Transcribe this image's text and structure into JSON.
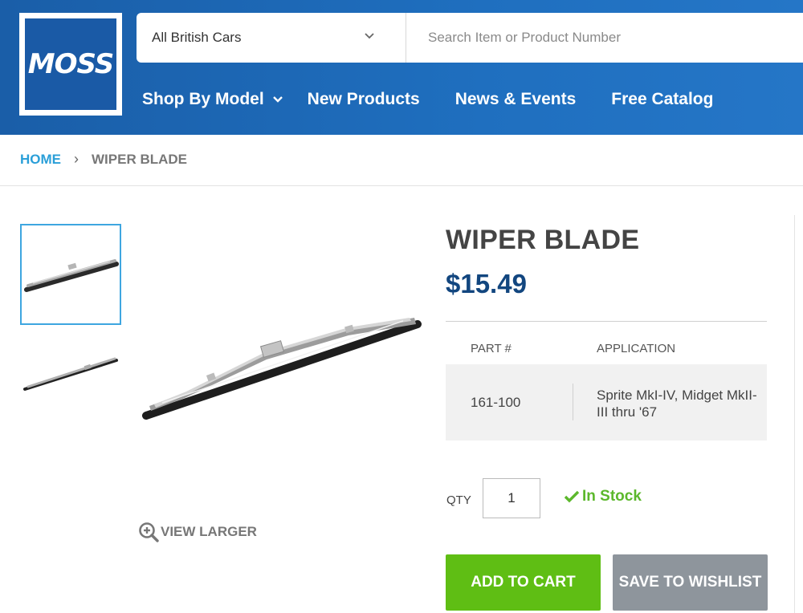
{
  "header": {
    "logo_text": "MOSS",
    "search": {
      "selected_make": "All British Cars",
      "placeholder": "Search Item or Product Number"
    },
    "nav": [
      {
        "label": "Shop By Model",
        "has_dropdown": true
      },
      {
        "label": "New Products"
      },
      {
        "label": "News & Events"
      },
      {
        "label": "Free Catalog"
      }
    ]
  },
  "breadcrumb": {
    "home": "HOME",
    "separator": "›",
    "current": "WIPER BLADE"
  },
  "product": {
    "title": "WIPER BLADE",
    "price": "$15.49",
    "table": {
      "headers": {
        "part": "PART #",
        "application": "APPLICATION"
      },
      "rows": [
        {
          "part": "161-100",
          "application": "Sprite MkI-IV, Midget MkII-III thru '67"
        }
      ]
    },
    "qty_label": "QTY",
    "qty_value": "1",
    "stock_status": "In Stock",
    "view_larger": "VIEW LARGER",
    "add_to_cart": "ADD TO CART",
    "save_to_wishlist": "SAVE TO WISHLIST"
  },
  "colors": {
    "header_blue": "#1f6fbf",
    "price_blue": "#12467f",
    "link_blue": "#2a9fd8",
    "cart_green": "#5fbe14",
    "stock_green": "#5cb82c",
    "wishlist_gray": "#8e959c"
  },
  "icons": {
    "select_chevron": "chevron-down-icon",
    "nav_caret": "chevron-down-icon",
    "view_larger": "zoom-in-icon",
    "stock": "checkmark-icon"
  }
}
